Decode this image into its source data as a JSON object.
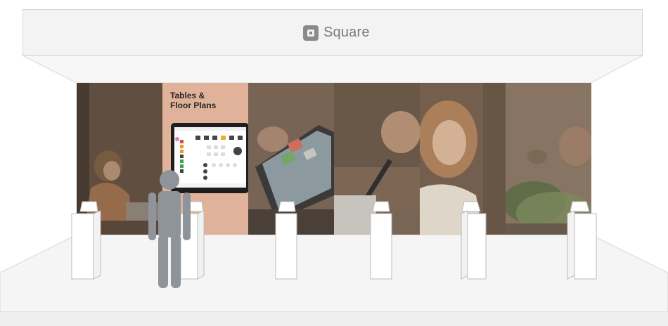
{
  "sign": {
    "brand": "Square"
  },
  "feature_panel": {
    "title_line1": "Tables &",
    "title_line2": "Floor Plans"
  },
  "colors": {
    "sign_bg": "#f3f3f3",
    "panel_peach": "#e0b29a",
    "floor": "#f4f4f4",
    "person": "#8f949a"
  },
  "icons": {
    "brand": "square-logo-icon",
    "person": "person-silhouette-icon"
  }
}
